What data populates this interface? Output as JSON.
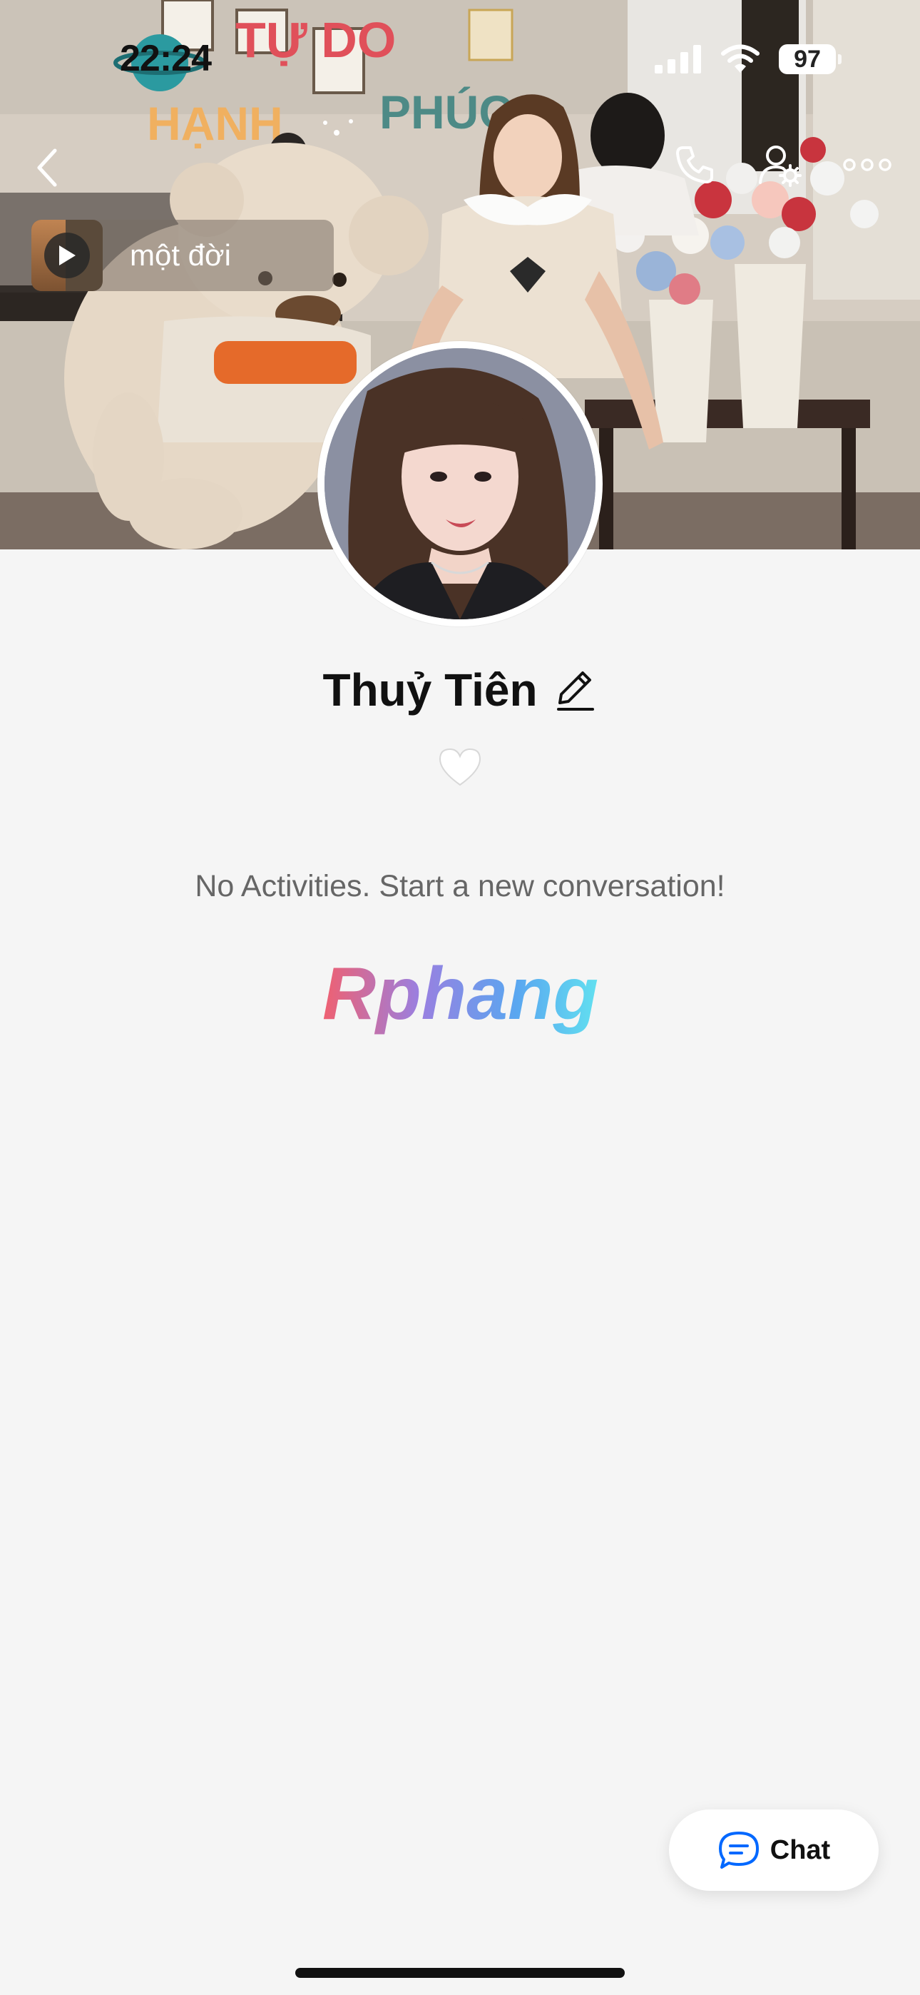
{
  "status_bar": {
    "time": "22:24",
    "battery": "97"
  },
  "cover": {
    "wall_sign_top": "TỰ DO",
    "wall_sign_left": "HẠNH",
    "wall_sign_right": "PHÚC"
  },
  "music": {
    "title": "một đời"
  },
  "profile": {
    "name": "Thuỷ Tiên",
    "empty_message": "No Activities. Start a new conversation!",
    "watermark": "Rphang"
  },
  "chat_button": {
    "label": "Chat"
  },
  "icons": {
    "back": "chevron-left-icon",
    "call": "phone-icon",
    "user_settings": "user-gear-icon",
    "more": "more-horizontal-icon",
    "play": "play-icon",
    "edit": "pencil-icon",
    "heart": "heart-icon",
    "chat": "chat-bubble-icon"
  },
  "colors": {
    "accent_blue": "#0068ff",
    "background": "#f5f5f5",
    "text_primary": "#111111",
    "text_secondary": "#666666"
  }
}
